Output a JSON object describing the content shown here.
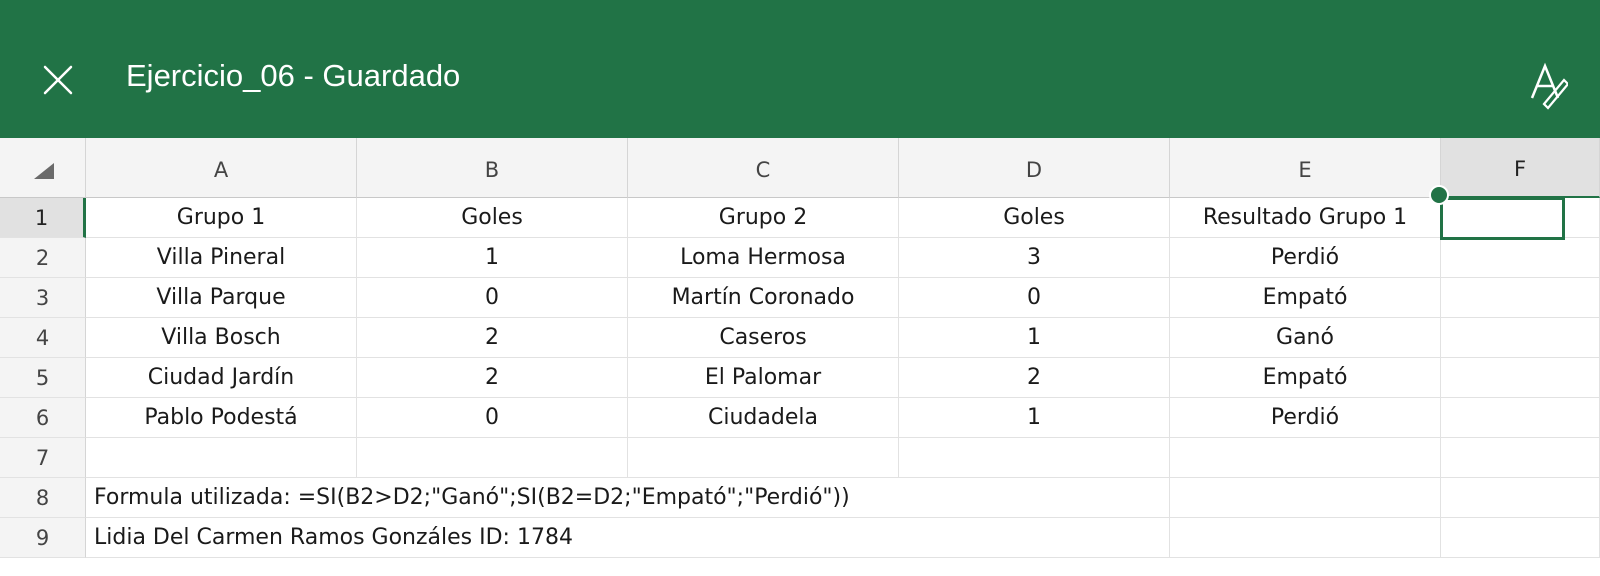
{
  "titlebar": {
    "doc_title": "Ejercicio_06 - Guardado",
    "close_icon": "close-icon",
    "draw_icon": "draw-pen-icon",
    "bg_color": "#217346"
  },
  "sheet": {
    "columns": [
      "A",
      "B",
      "C",
      "D",
      "E",
      "F"
    ],
    "rows": [
      "1",
      "2",
      "3",
      "4",
      "5",
      "6",
      "7",
      "8",
      "9"
    ],
    "selected_cell": "F1",
    "data": [
      [
        "Grupo 1",
        "Goles",
        "Grupo 2",
        "Goles",
        "Resultado Grupo 1",
        ""
      ],
      [
        "Villa Pineral",
        "1",
        "Loma Hermosa",
        "3",
        "Perdió",
        ""
      ],
      [
        "Villa Parque",
        "0",
        "Martín Coronado",
        "0",
        "Empató",
        ""
      ],
      [
        "Villa Bosch",
        "2",
        "Caseros",
        "1",
        "Ganó",
        ""
      ],
      [
        "Ciudad Jardín",
        "2",
        "El Palomar",
        "2",
        "Empató",
        ""
      ],
      [
        "Pablo Podestá",
        "0",
        "Ciudadela",
        "1",
        "Perdió",
        ""
      ],
      [
        "",
        "",
        "",
        "",
        "",
        ""
      ]
    ],
    "note_formula": "Formula utilizada: =SI(B2>D2;\"Ganó\";SI(B2=D2;\"Empató\";\"Perdió\"))",
    "note_author": "Lidia Del Carmen Ramos Gonzáles    ID: 1784"
  }
}
